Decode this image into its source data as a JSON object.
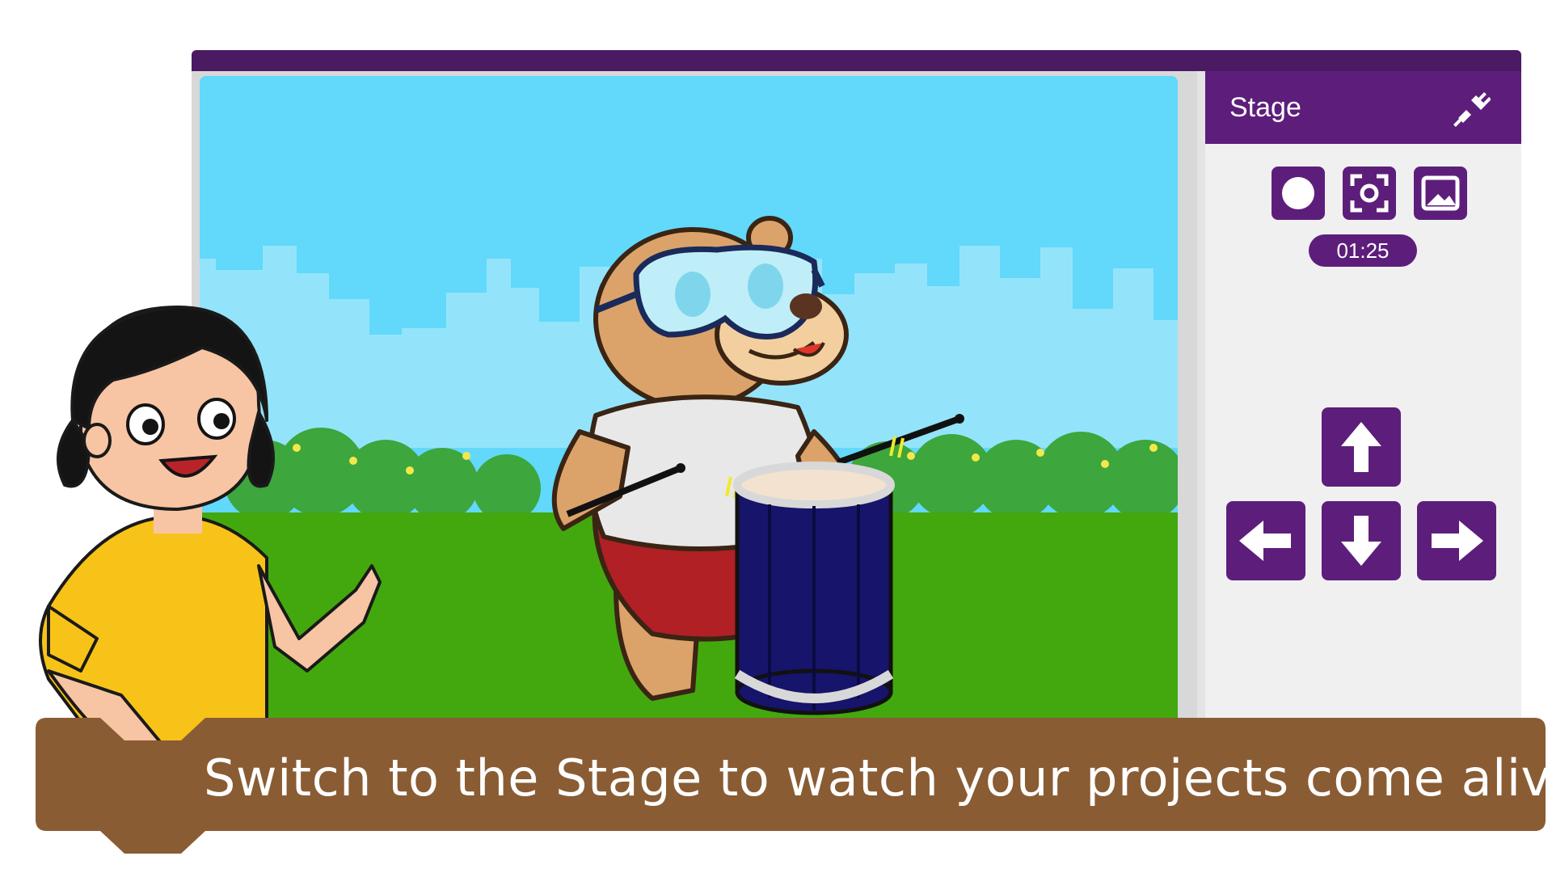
{
  "panel": {
    "title": "Stage",
    "connect_icon": "plug-connect-icon",
    "tools": [
      {
        "name": "record-button",
        "icon": "record-icon"
      },
      {
        "name": "screenshot-button",
        "icon": "camera-focus-icon"
      },
      {
        "name": "backdrop-button",
        "icon": "image-icon"
      }
    ],
    "timer": "01:25",
    "arrows": [
      "up",
      "left",
      "down",
      "right"
    ]
  },
  "caption": {
    "text": "Switch to the Stage to watch your projects come alive."
  },
  "colors": {
    "purple": "#5d1e7b",
    "dark_purple": "#4a1a63",
    "sky": "#62d8fb",
    "grass": "#43a80e",
    "caption_bg": "#8a5c33"
  }
}
